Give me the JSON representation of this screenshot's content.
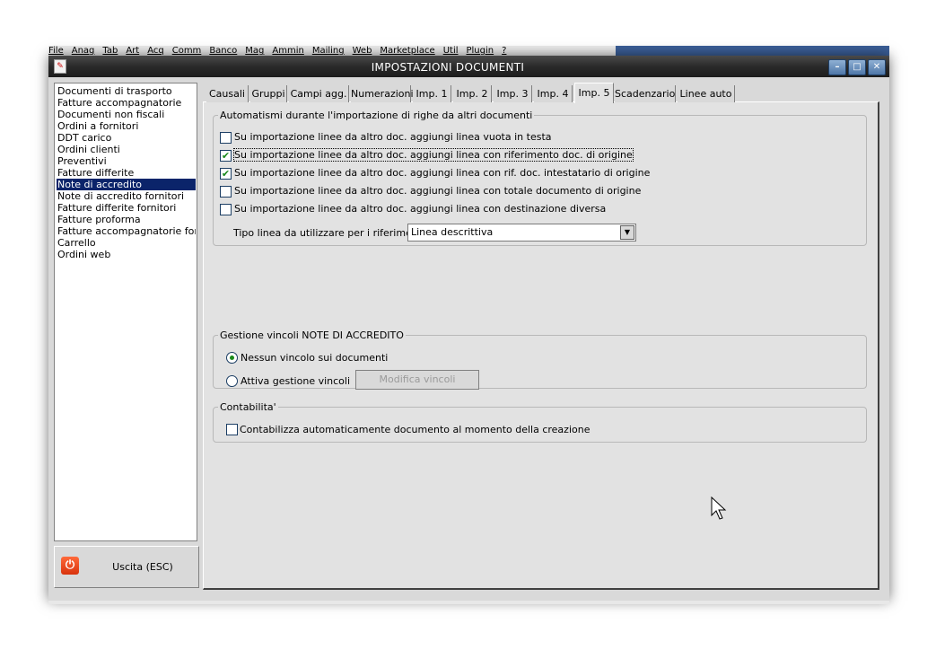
{
  "background_menubar": [
    "File",
    "Anag",
    "Tab",
    "Art",
    "Acq",
    "Comm",
    "Banco",
    "Mag",
    "Ammin",
    "Mailing",
    "Web",
    "Marketplace",
    "Util",
    "Plugin",
    "?"
  ],
  "window": {
    "title": "IMPOSTAZIONI DOCUMENTI",
    "controls": {
      "minimize": "–",
      "maximize": "□",
      "close": "✕"
    }
  },
  "doc_list": {
    "items": [
      "Documenti di trasporto",
      "Fatture accompagnatorie",
      "Documenti non fiscali",
      "Ordini a fornitori",
      "DDT carico",
      "Ordini clienti",
      "Preventivi",
      "Fatture differite",
      "Note di accredito",
      "Note di accredito fornitori",
      "Fatture differite fornitori",
      "Fatture proforma",
      "Fatture accompagnatorie fornitori",
      "Carrello",
      "Ordini web"
    ],
    "selected_index": 8
  },
  "exit_button": {
    "label": "Uscita (ESC)"
  },
  "tabs": [
    {
      "label": "Causali"
    },
    {
      "label": "Gruppi"
    },
    {
      "label": "Campi agg."
    },
    {
      "label": "Numerazioni"
    },
    {
      "label": "Imp. 1"
    },
    {
      "label": "Imp. 2"
    },
    {
      "label": "Imp. 3"
    },
    {
      "label": "Imp. 4"
    },
    {
      "label": "Imp. 5"
    },
    {
      "label": "Scadenzario"
    },
    {
      "label": "Linee auto"
    }
  ],
  "active_tab_index": 8,
  "automatismi": {
    "legend": "Automatismi durante l'importazione di righe da altri documenti",
    "options": [
      {
        "label": "Su importazione linee da altro doc. aggiungi linea vuota in testa",
        "checked": false
      },
      {
        "label": "Su importazione linee da altro doc. aggiungi linea con riferimento doc. di origine",
        "checked": true
      },
      {
        "label": "Su importazione linee da altro doc. aggiungi linea con rif. doc. intestatario di origine",
        "checked": true
      },
      {
        "label": "Su importazione linee da altro doc. aggiungi linea con totale documento di origine",
        "checked": false
      },
      {
        "label": "Su importazione linee da altro doc. aggiungi linea con destinazione diversa",
        "checked": false
      }
    ],
    "tipo_linea_label": "Tipo linea da utilizzare per i riferimenti :",
    "tipo_linea_value": "Linea descrittiva"
  },
  "vincoli": {
    "legend": "Gestione vincoli NOTE DI ACCREDITO",
    "option_none": "Nessun vincolo sui documenti",
    "option_active": "Attiva gestione vincoli",
    "selected": "none",
    "modify_button": "Modifica vincoli"
  },
  "contabilita": {
    "legend": "Contabilita'",
    "option": "Contabilizza automaticamente documento al momento della creazione",
    "checked": false
  }
}
